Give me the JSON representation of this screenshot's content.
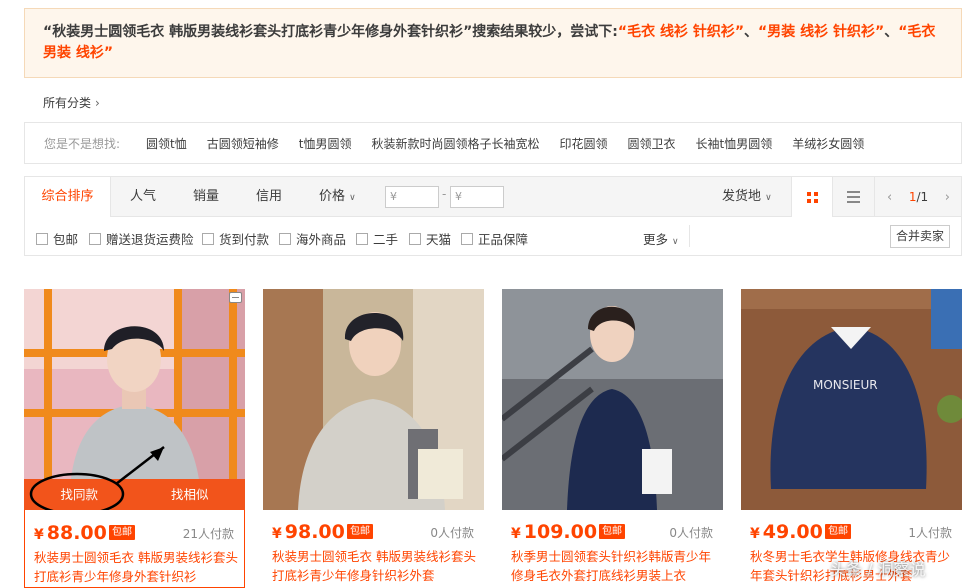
{
  "notice": {
    "prefix": "“秋装男士圆领毛衣 韩版男装线衫套头打底衫青少年修身外套针织衫”搜索结果较少，尝试下:",
    "suggestions": [
      "“毛衣 线衫 针织衫”",
      "“男装 线衫 针织衫”",
      "“毛衣 男装 线衫”"
    ],
    "separator": "、"
  },
  "all_categories": {
    "label": "所有分类"
  },
  "did_you_mean": {
    "label": "您是不是想找:",
    "keywords": [
      "圆领t恤",
      "古圆领短袖修",
      "t恤男圆领",
      "秋装新款时尚圆领格子长袖宽松",
      "印花圆领",
      "圆领卫衣",
      "长袖t恤男圆领",
      "羊绒衫女圆领"
    ]
  },
  "sort": {
    "tabs": [
      "综合排序",
      "人气",
      "销量",
      "信用",
      "价格"
    ],
    "price_min_placeholder": "¥",
    "price_max_placeholder": "¥",
    "price_dash": "-",
    "ship_from": "发货地",
    "pager": {
      "prev": "‹",
      "current": "1",
      "total": "/1",
      "next": "›"
    }
  },
  "filters": {
    "checkboxes": [
      "包邮",
      "赠送退货运费险",
      "货到付款",
      "海外商品",
      "二手",
      "天猫",
      "正品保障"
    ],
    "more": "更多",
    "merge": "合并卖家"
  },
  "products": [
    {
      "price": "88.00",
      "badge": "包邮",
      "paid": "21人付款",
      "title_line1": "秋装男士圆领毛衣 韩版男装线衫套头",
      "title_line2": "打底衫青少年修身外套针织衫",
      "actions": [
        "找同款",
        "找相似"
      ]
    },
    {
      "price": "98.00",
      "badge": "包邮",
      "paid": "0人付款",
      "title_line1": "秋装男士圆领毛衣 韩版男装线衫套头",
      "title_line2": "打底衫青少年修身针织衫外套"
    },
    {
      "price": "109.00",
      "badge": "包邮",
      "paid": "0人付款",
      "title_line1": "秋季男士圆领套头针织衫韩版青少年",
      "title_line2": "修身毛衣外套打底线衫男装上衣"
    },
    {
      "price": "49.00",
      "badge": "包邮",
      "paid": "1人付款",
      "title_line1": "秋冬男士毛衣学生韩版修身线衣青少",
      "title_line2": "年套头针织衫打底衫男士外套"
    }
  ],
  "watermark": "头条 / 洞察说",
  "colors": {
    "accent": "#ff4400",
    "notice_bg": "#fef6ec"
  }
}
